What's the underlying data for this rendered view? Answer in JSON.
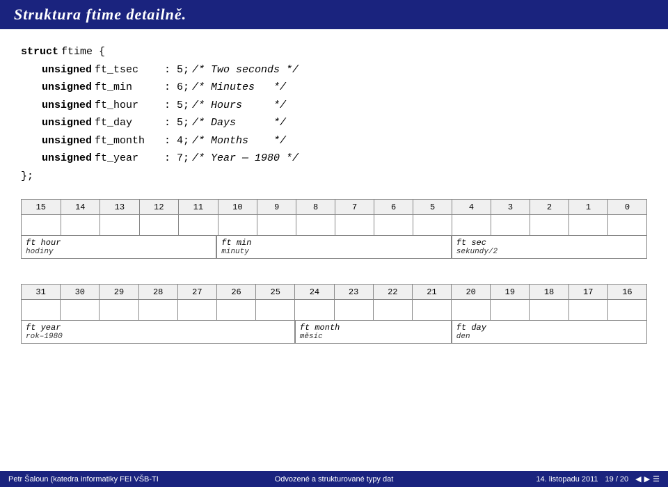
{
  "header": {
    "title": "Struktura ftime detailně."
  },
  "code": {
    "struct_keyword": "struct",
    "struct_name": "ftime",
    "open_brace": "{",
    "fields": [
      {
        "keyword": "unsigned",
        "name": "ft_tsec",
        "colon": ":",
        "bits": "5;",
        "comment": "/* Two seconds */"
      },
      {
        "keyword": "unsigned",
        "name": "ft_min",
        "colon": ":",
        "bits": "6;",
        "comment": "/* Minutes    */"
      },
      {
        "keyword": "unsigned",
        "name": "ft_hour",
        "colon": ":",
        "bits": "5;",
        "comment": "/* Hours      */"
      },
      {
        "keyword": "unsigned",
        "name": "ft_day",
        "colon": ":",
        "bits": "5;",
        "comment": "/* Days       */"
      },
      {
        "keyword": "unsigned",
        "name": "ft_month",
        "colon": ":",
        "bits": "4;",
        "comment": "/* Months     */"
      },
      {
        "keyword": "unsigned",
        "name": "ft_year",
        "colon": ":",
        "bits": "7;",
        "comment": "/* Year — 1980 */"
      }
    ],
    "close": "};"
  },
  "diagram1": {
    "bits": [
      "15",
      "14",
      "13",
      "12",
      "11",
      "10",
      "9",
      "8",
      "7",
      "6",
      "5",
      "4",
      "3",
      "2",
      "1",
      "0"
    ],
    "fields": [
      {
        "name_eng": "ft_hour",
        "name_cz": "hodiny",
        "span": 5
      },
      {
        "name_eng": "ft_min",
        "name_cz": "minuty",
        "span": 6
      },
      {
        "name_eng": "ft_sec",
        "name_cz": "sekundy/2",
        "span": 5
      }
    ]
  },
  "diagram2": {
    "bits": [
      "31",
      "30",
      "29",
      "28",
      "27",
      "26",
      "25",
      "24",
      "23",
      "22",
      "21",
      "20",
      "19",
      "18",
      "17",
      "16"
    ],
    "fields": [
      {
        "name_eng": "ft_year",
        "name_cz": "rok–1980",
        "span": 7
      },
      {
        "name_eng": "ft_month",
        "name_cz": "měsíc",
        "span": 4
      },
      {
        "name_eng": "ft_day",
        "name_cz": "den",
        "span": 5
      }
    ]
  },
  "footer": {
    "left": "Petr Šaloun (katedra informatiky FEI VŠB-TI",
    "center": "Odvozené a strukturované typy dat",
    "right": "14. listopadu 2011",
    "page": "19 / 20"
  }
}
